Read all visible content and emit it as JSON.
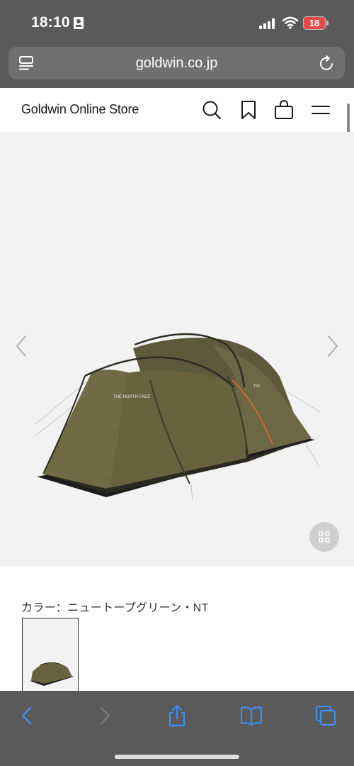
{
  "status_bar": {
    "time": "18:10",
    "battery_level": "18",
    "battery_color": "#e34b4b",
    "icons": [
      "id-card-icon",
      "signal-icon",
      "wifi-icon",
      "battery-icon"
    ]
  },
  "browser": {
    "url": "goldwin.co.jp",
    "icons": [
      "reader-mode-icon",
      "reload-icon"
    ]
  },
  "site_header": {
    "store_name": "Goldwin Online Store",
    "icons": [
      "search-icon",
      "bookmark-icon",
      "cart-icon",
      "menu-icon"
    ]
  },
  "product": {
    "image_subject": "tent",
    "color_label": "カラー：ニュートープグリーン・NT",
    "gallery_icons": [
      "chevron-left-icon",
      "chevron-right-icon",
      "grid-icon"
    ]
  },
  "toolbar": {
    "icons": [
      "back-icon",
      "forward-icon",
      "share-icon",
      "bookmarks-icon",
      "tabs-icon"
    ],
    "accent_color": "#3d8ef7"
  }
}
